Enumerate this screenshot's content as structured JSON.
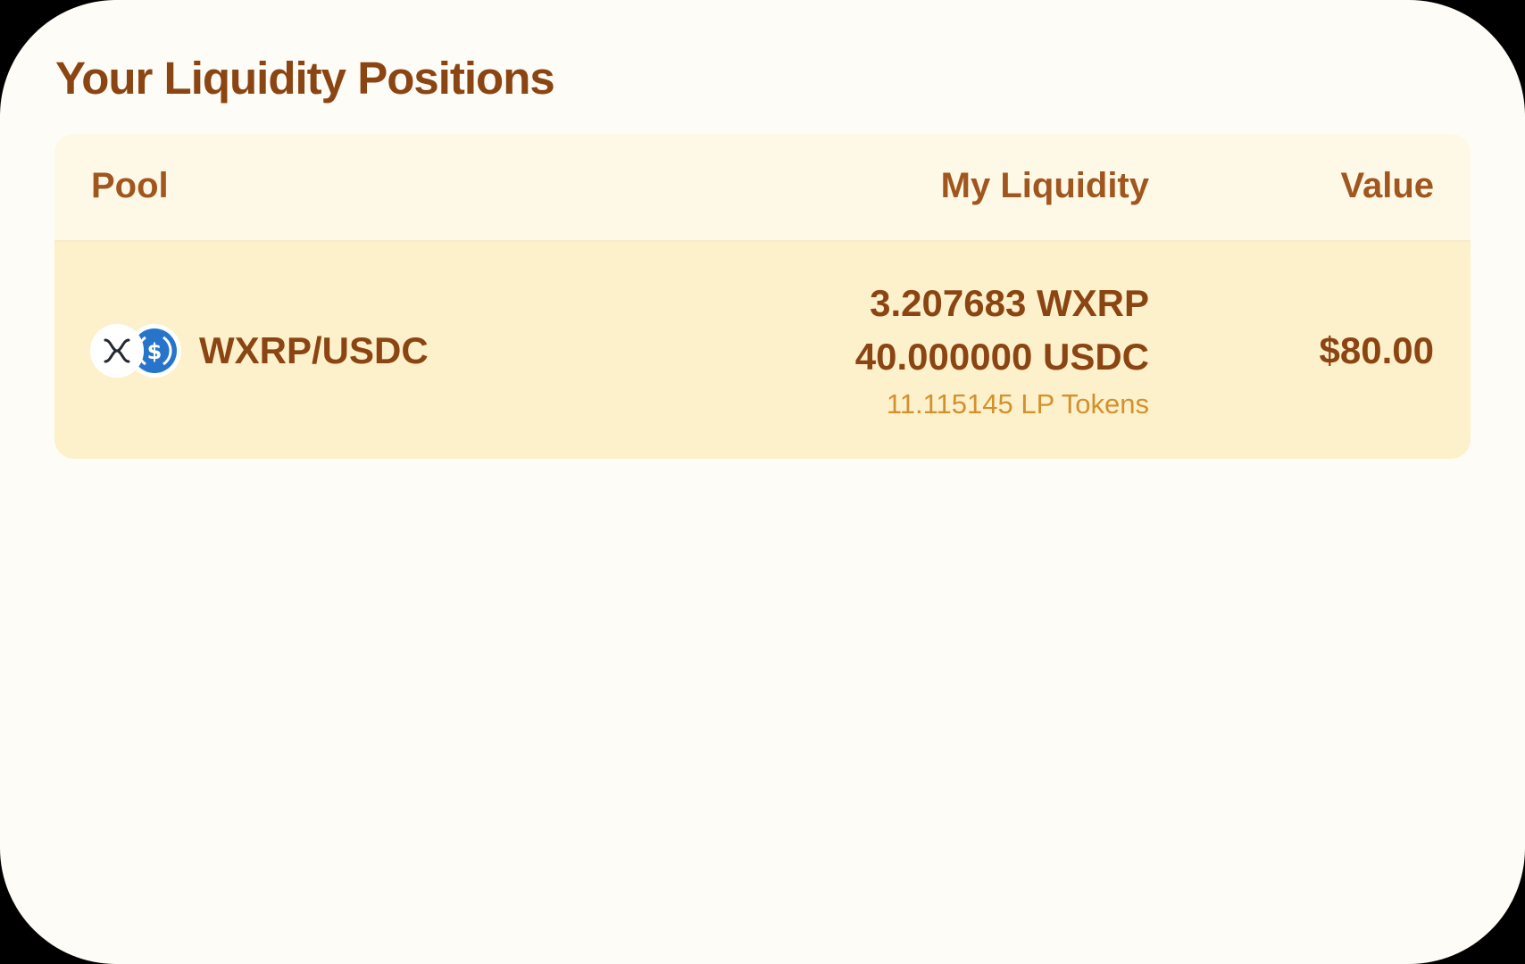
{
  "page": {
    "title": "Your Liquidity Positions"
  },
  "table": {
    "headers": {
      "pool": "Pool",
      "my_liquidity": "My Liquidity",
      "value": "Value"
    },
    "rows": [
      {
        "pool": "WXRP/USDC",
        "token_icons": [
          "xrp-icon",
          "usdc-icon"
        ],
        "liquidity_lines": [
          "3.207683 WXRP",
          "40.000000 USDC"
        ],
        "lp_tokens": "11.115145 LP Tokens",
        "value": "$80.00"
      }
    ]
  },
  "colors": {
    "title": "#8b4513",
    "header_text": "#a0561f",
    "row_background": "#fdf1cc",
    "lp_text": "#d4902c",
    "usdc_blue": "#2775ca"
  }
}
